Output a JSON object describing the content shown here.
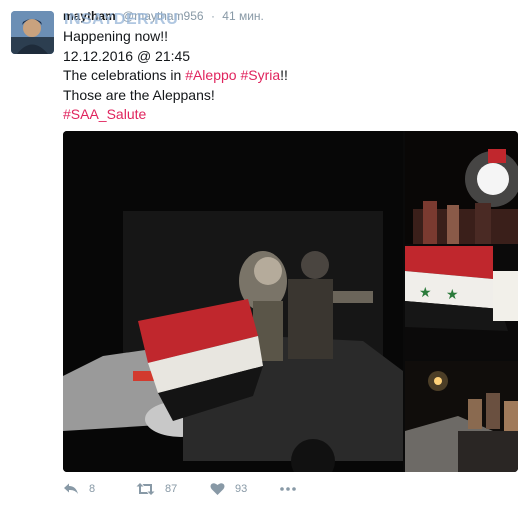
{
  "tweet": {
    "author_name": "maytham",
    "author_handle": "@maytham956",
    "separator": "·",
    "time": "41 мин.",
    "watermark": "INSAYDER.RU",
    "lines": [
      "Happening now!!",
      "12.12.2016 @ 21:45"
    ],
    "line3_prefix": "The celebrations in ",
    "hashtag_aleppo": "#Aleppo",
    "hashtag_syria": "#Syria",
    "line3_suffix": "!!",
    "line4": "Those are the Aleppans!",
    "hashtag_saa": "#SAA_Salute"
  },
  "actions": {
    "reply_icon": "reply-icon",
    "reply_count": "8",
    "retweet_icon": "retweet-icon",
    "retweet_count": "87",
    "like_icon": "heart-icon",
    "like_count": "93",
    "more_icon": "more-icon"
  },
  "colors": {
    "hashtag": "#e0245e",
    "muted": "#8899a6",
    "text": "#14171a"
  }
}
